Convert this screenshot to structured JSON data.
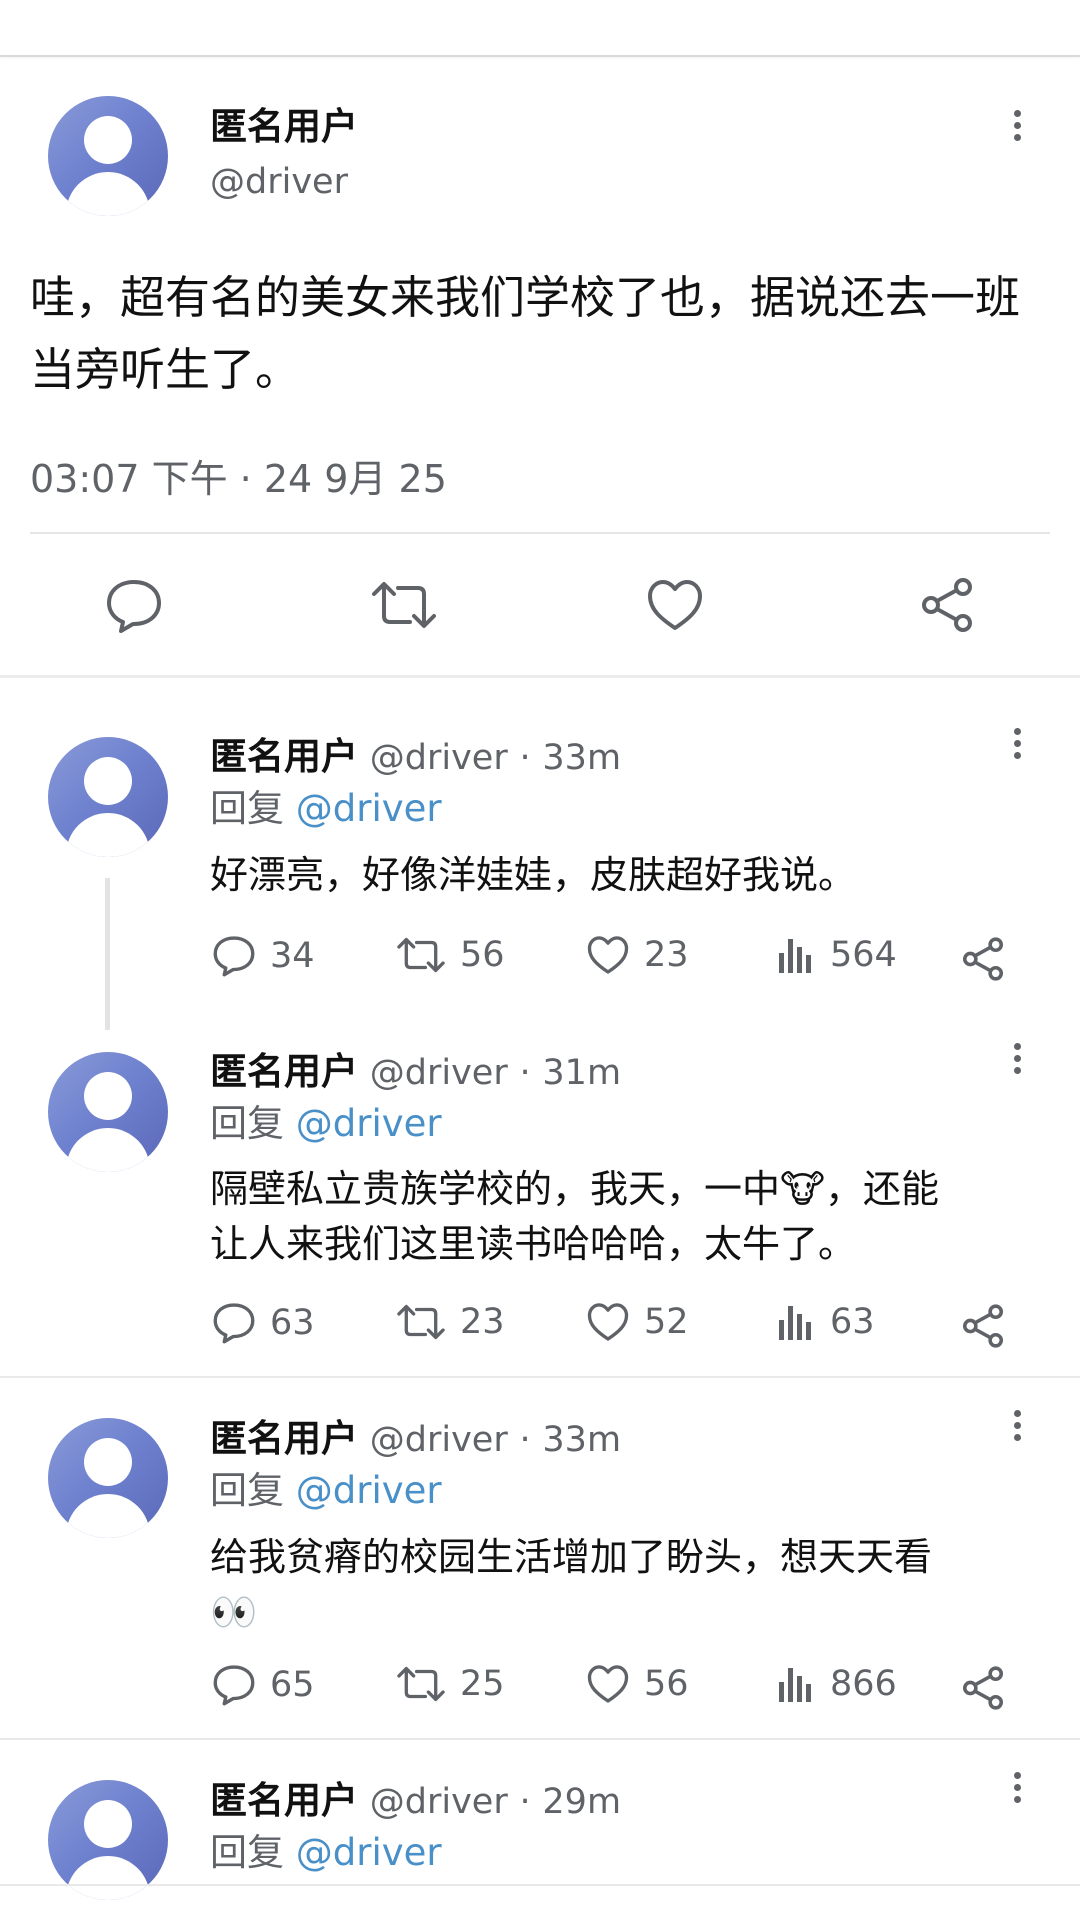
{
  "main_post": {
    "name": "匿名用户",
    "handle": "@driver",
    "text": "哇，超有名的美女来我们学校了也，据说还去一班当旁听生了。",
    "timestamp": "03:07 下午 · 24 9月 25",
    "actions": [
      "reply-icon",
      "retweet-icon",
      "like-icon",
      "share-icon"
    ]
  },
  "replies": [
    {
      "name": "匿名用户",
      "handle": "@driver",
      "time": "33m",
      "reply_label": "回复",
      "reply_to": "@driver",
      "text": "好漂亮，好像洋娃娃，皮肤超好我说。",
      "replies": "34",
      "retweets": "56",
      "likes": "23",
      "views": "564"
    },
    {
      "name": "匿名用户",
      "handle": "@driver",
      "time": "31m",
      "reply_label": "回复",
      "reply_to": "@driver",
      "text_line1": "隔壁私立贵族学校的，我天，一中🐮，还能",
      "text_line2": "让人来我们这里读书哈哈哈，太牛了。",
      "replies": "63",
      "retweets": "23",
      "likes": "52",
      "views": "63"
    },
    {
      "name": "匿名用户",
      "handle": "@driver",
      "time": "33m",
      "reply_label": "回复",
      "reply_to": "@driver",
      "text_line1": "给我贫瘠的校园生活增加了盼头，想天天看",
      "text_line2": "👀",
      "replies": "65",
      "retweets": "25",
      "likes": "56",
      "views": "866"
    },
    {
      "name": "匿名用户",
      "handle": "@driver",
      "time": "29m",
      "reply_label": "回复",
      "reply_to": "@driver"
    }
  ],
  "colors": {
    "link": "#4a90c8",
    "muted": "#5f6368",
    "avatar": "#6f82cf"
  },
  "separator": "·"
}
